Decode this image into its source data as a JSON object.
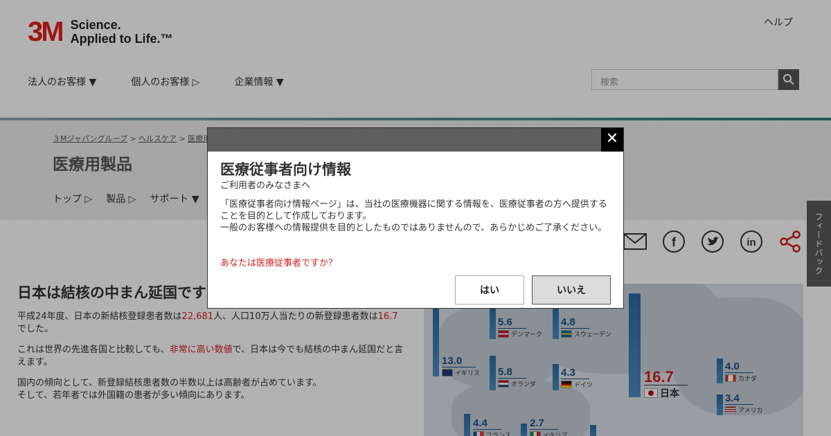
{
  "header": {
    "logo_mark": "3M",
    "tagline_line1": "Science.",
    "tagline_line2": "Applied to Life.™",
    "help": "ヘルプ",
    "nav": [
      "法人のお客様 ▼",
      "個人のお客様 ▷",
      "企業情報 ▼"
    ],
    "search_placeholder": "検索"
  },
  "breadcrumb": [
    "３Mジャパングループ",
    "ヘルスケア",
    "医療用"
  ],
  "section_title": "医療用製品",
  "sub_nav": [
    "トップ ▷",
    "製品 ▷",
    "サポート ▼"
  ],
  "article": {
    "title": "日本は結核の中まん延国です",
    "p1_a": "平成24年度、日本の新結核登録患者数は",
    "p1_b": "22,681",
    "p1_c": "人、人口10万人当たりの新登録患者数は",
    "p1_d": "16.7",
    "p1_e": "でした。",
    "p2_a": "これは世界の先進各国と比較しても、",
    "p2_b": "非常に高い数値",
    "p2_c": "で、日本は今でも結核の中まん延国だと言えます。",
    "p3_l1": "国内の傾向として、新登録結核患者数の半数以上は高齢者が占めています。",
    "p3_l2": "そして、若年者では外国籍の患者が多い傾向にあります。"
  },
  "feedback": "フィードバック",
  "map": {
    "countries": [
      {
        "name": "イギリス",
        "value": "13.0"
      },
      {
        "name": "デンマーク",
        "value": "5.6"
      },
      {
        "name": "オランダ",
        "value": "5.8"
      },
      {
        "name": "スウェーデン",
        "value": "4.8"
      },
      {
        "name": "ドイツ",
        "value": "4.3"
      },
      {
        "name": "日本",
        "value": "16.7"
      },
      {
        "name": "カナダ",
        "value": "4.0"
      },
      {
        "name": "アメリカ",
        "value": "3.4"
      },
      {
        "name": "フランス",
        "value": "4.4"
      },
      {
        "name": "イタリア",
        "value": "2.7"
      }
    ]
  },
  "modal": {
    "title": "医療従事者向け情報",
    "subtitle": "ご利用者のみなさまへ",
    "body_1": "「医療従事者向け情報ページ」は、当社の医療機器に関する情報を、医療従事者の方へ提供することを目的として作成しております。",
    "body_2": "一般のお客様への情報提供を目的としたものではありませんので、あらかじめご了承ください。",
    "question": "あなたは医療従事者ですか？",
    "yes": "はい",
    "no": "いいえ",
    "close": "✕"
  },
  "colors": {
    "brand_red": "#e3201b",
    "accent_red": "#d21f1f",
    "bar_blue": "#2b6aa8"
  }
}
